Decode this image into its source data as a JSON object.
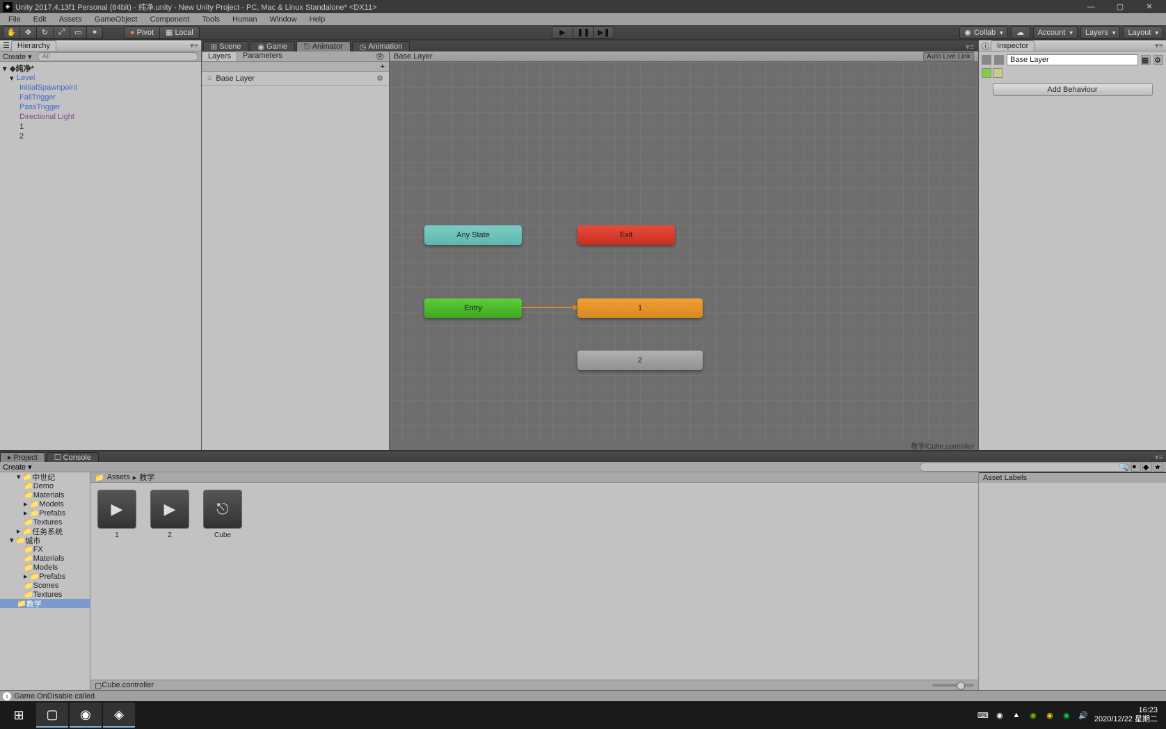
{
  "titlebar": {
    "title": "Unity 2017.4.13f1 Personal (64bit) - 纯净.unity - New Unity Project - PC, Mac & Linux Standalone* <DX11>"
  },
  "menubar": [
    "File",
    "Edit",
    "Assets",
    "GameObject",
    "Component",
    "Tools",
    "Human",
    "Window",
    "Help"
  ],
  "toolbar": {
    "pivot": "Pivot",
    "local": "Local",
    "collab": "Collab",
    "account": "Account",
    "layers": "Layers",
    "layout": "Layout"
  },
  "hierarchy": {
    "title": "Hierarchy",
    "create": "Create",
    "search_placeholder": "All",
    "scene": "纯净*",
    "items": [
      {
        "name": "Level",
        "depth": 1,
        "expanded": true
      },
      {
        "name": "InitialSpawnpoint",
        "depth": 2,
        "cls": "blue-link"
      },
      {
        "name": "FallTrigger",
        "depth": 2,
        "cls": "blue-link"
      },
      {
        "name": "PassTrigger",
        "depth": 2,
        "cls": "blue-link"
      },
      {
        "name": "Directional Light",
        "depth": 2,
        "cls": "prefab-link"
      },
      {
        "name": "1",
        "depth": 2
      },
      {
        "name": "2",
        "depth": 2
      }
    ]
  },
  "center": {
    "tabs": [
      {
        "label": "Scene",
        "active": false
      },
      {
        "label": "Game",
        "active": false
      },
      {
        "label": "Animator",
        "active": true
      },
      {
        "label": "Animation",
        "active": false
      }
    ],
    "animator": {
      "left_tabs": [
        "Layers",
        "Parameters"
      ],
      "active_left_tab": "Layers",
      "layer_name": "Base Layer",
      "breadcrumb": "Base Layer",
      "auto_live": "Auto Live Link",
      "nodes": {
        "any": "Any State",
        "exit": "Exit",
        "entry": "Entry",
        "one": "1",
        "two": "2"
      },
      "controller_path": "教学/Cube.controller"
    }
  },
  "inspector": {
    "title": "Inspector",
    "name": "Base Layer",
    "add_behaviour": "Add Behaviour"
  },
  "project": {
    "tabs": [
      "Project",
      "Console"
    ],
    "create": "Create",
    "breadcrumb": [
      "Assets",
      "教学"
    ],
    "tree": [
      {
        "name": "中世纪",
        "depth": 2,
        "exp": "▾"
      },
      {
        "name": "Demo",
        "depth": 3,
        "folder": true
      },
      {
        "name": "Materials",
        "depth": 3,
        "folder": true
      },
      {
        "name": "Models",
        "depth": 3,
        "exp": "▸"
      },
      {
        "name": "Prefabs",
        "depth": 3,
        "exp": "▸"
      },
      {
        "name": "Textures",
        "depth": 3,
        "folder": true
      },
      {
        "name": "任务系统",
        "depth": 2,
        "exp": "▸"
      },
      {
        "name": "城市",
        "depth": 1,
        "exp": "▾"
      },
      {
        "name": "FX",
        "depth": 3,
        "folder": true
      },
      {
        "name": "Materials",
        "depth": 3,
        "folder": true
      },
      {
        "name": "Models",
        "depth": 3,
        "folder": true
      },
      {
        "name": "Prefabs",
        "depth": 3,
        "exp": "▸"
      },
      {
        "name": "Scenes",
        "depth": 3,
        "folder": true
      },
      {
        "name": "Textures",
        "depth": 3,
        "folder": true
      },
      {
        "name": "教学",
        "depth": 2,
        "sel": true
      }
    ],
    "assets": [
      {
        "name": "1",
        "type": "anim"
      },
      {
        "name": "2",
        "type": "anim"
      },
      {
        "name": "Cube",
        "type": "controller"
      }
    ],
    "footer": "Cube.controller",
    "asset_labels": "Asset Labels"
  },
  "statusbar": {
    "message": "Game.OnDisable called"
  },
  "taskbar": {
    "time": "16:23",
    "date": "2020/12/22 星期二"
  }
}
